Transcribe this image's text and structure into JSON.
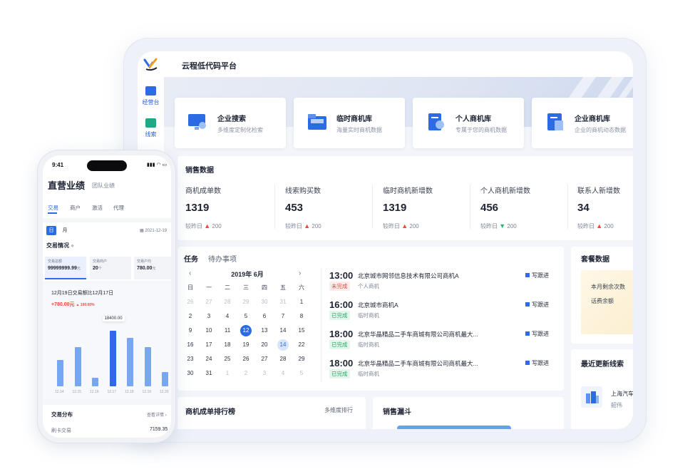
{
  "tablet": {
    "app_title": "云程低代码平台",
    "nav": [
      {
        "label": "经营台",
        "icon": "monitor-icon"
      },
      {
        "label": "线索",
        "icon": "clue-icon"
      }
    ],
    "quick_cards": [
      {
        "title": "企业搜索",
        "sub": "多维度定制化检索",
        "icon": "search-monitor-icon"
      },
      {
        "title": "临时商机库",
        "sub": "海量实时商机数据",
        "icon": "folder-icon"
      },
      {
        "title": "个人商机库",
        "sub": "专属于您的商机数据",
        "icon": "user-doc-icon"
      },
      {
        "title": "企业商机库",
        "sub": "企业的商机动态数据",
        "icon": "enterprise-doc-icon"
      }
    ],
    "sales": {
      "title": "销售数据",
      "stats": [
        {
          "label": "商机成单数",
          "value": "1319",
          "cmp": "较昨日",
          "delta": "200",
          "dir": "up"
        },
        {
          "label": "线索购买数",
          "value": "453",
          "cmp": "较昨日",
          "delta": "200",
          "dir": "up"
        },
        {
          "label": "临时商机新增数",
          "value": "1319",
          "cmp": "较昨日",
          "delta": "200",
          "dir": "up"
        },
        {
          "label": "个人商机新增数",
          "value": "456",
          "cmp": "较昨日",
          "delta": "200",
          "dir": "down"
        },
        {
          "label": "联系人新增数",
          "value": "34",
          "cmp": "较昨日",
          "delta": "200",
          "dir": "up"
        }
      ]
    },
    "tasks": {
      "tab_active": "任务",
      "tab_other": "待办事项",
      "month": "2019年 6月",
      "weekdays": [
        "日",
        "一",
        "二",
        "三",
        "四",
        "五",
        "六"
      ],
      "days": [
        [
          "26",
          "27",
          "28",
          "29",
          "30",
          "31",
          "1"
        ],
        [
          "2",
          "3",
          "4",
          "5",
          "6",
          "7",
          "8"
        ],
        [
          "9",
          "10",
          "11",
          "12",
          "13",
          "14",
          "15"
        ],
        [
          "16",
          "17",
          "18",
          "19",
          "20",
          "14",
          "22"
        ],
        [
          "23",
          "24",
          "25",
          "26",
          "27",
          "28",
          "29"
        ],
        [
          "30",
          "31",
          "1",
          "2",
          "3",
          "4",
          "5"
        ]
      ],
      "items": [
        {
          "time": "13:00",
          "name": "北京城市网邻信息技术有限公司商机A",
          "status": "未完成",
          "cat": "个人商机",
          "follow": "写跟进",
          "state": "red"
        },
        {
          "time": "16:00",
          "name": "北京城市商机A",
          "status": "已完成",
          "cat": "临时商机",
          "follow": "写跟进",
          "state": "green"
        },
        {
          "time": "18:00",
          "name": "北京华晶精品二手车商城有限公司商机最大...",
          "status": "已完成",
          "cat": "临时商机",
          "follow": "写跟进",
          "state": "green"
        },
        {
          "time": "18:00",
          "name": "北京华晶精品二手车商城有限公司商机最大...",
          "status": "已完成",
          "cat": "临时商机",
          "follow": "写跟进",
          "state": "green"
        }
      ]
    },
    "package": {
      "title": "套餐数据",
      "line1": "本月剩余次数",
      "line2": "话费余额"
    },
    "recent": {
      "title": "最近更新线索",
      "name": "上海汽车",
      "sub": "韶伟"
    },
    "ranking": {
      "title": "商机成单排行榜",
      "link": "多维度排行"
    },
    "funnel": {
      "title": "销售漏斗"
    },
    "colors": {
      "primary": "#2d6be4",
      "up": "#e84a3c",
      "down": "#27b36d"
    }
  },
  "phone": {
    "time": "9:41",
    "title": "直营业绩",
    "subtitle": "团队业绩",
    "tabs": [
      "交易",
      "商户",
      "激活",
      "代理"
    ],
    "period_day": "日",
    "period_month": "月",
    "date": "2021-12-19",
    "section": "交易情况",
    "kpis": [
      {
        "label": "交易总额",
        "value": "99999999.99",
        "unit": "元"
      },
      {
        "label": "交易商户",
        "value": "20",
        "unit": "个"
      },
      {
        "label": "交易户均",
        "value": "780.00",
        "unit": "元"
      }
    ],
    "compare": "12月19日交易额比12月17日",
    "delta": "+780.00",
    "delta_unit": "元",
    "delta_pct": "100.00%",
    "tooltip": "18400.00",
    "chart_data": {
      "type": "bar",
      "categories": [
        "12.14",
        "12.15",
        "12.16",
        "12.17",
        "12.18",
        "12.19",
        "12.20"
      ],
      "values": [
        9000,
        13500,
        3000,
        19000,
        16500,
        13500,
        5000
      ],
      "highlight_index": 3,
      "ylim": [
        0,
        20000
      ]
    },
    "dist_title": "交易分布",
    "dist_link": "查看详情",
    "dist_row_label": "刷卡交易",
    "dist_row_value": "7159.35"
  }
}
